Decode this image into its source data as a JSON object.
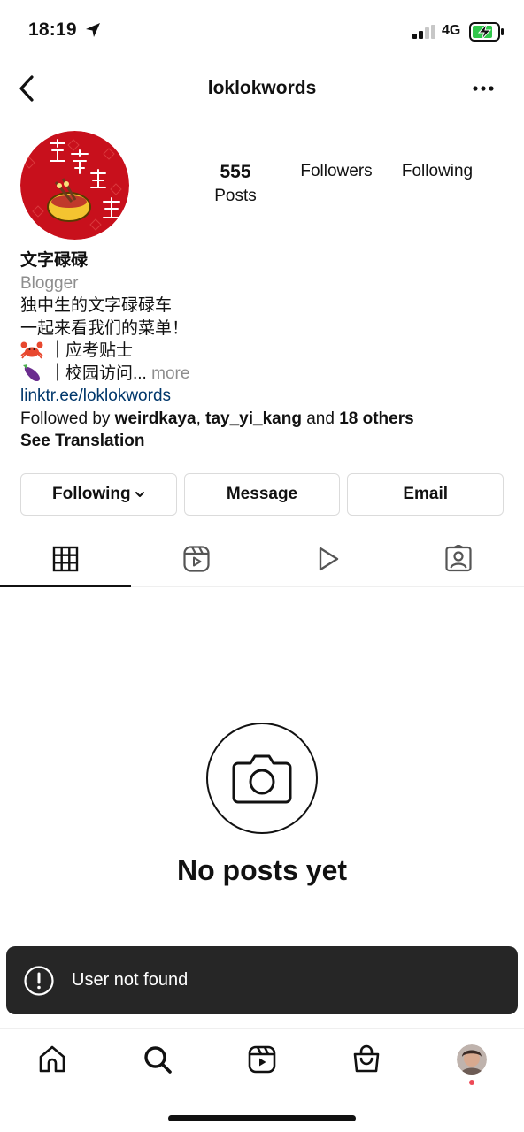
{
  "status_bar": {
    "time": "18:19",
    "network": "4G"
  },
  "header": {
    "username": "loklokwords"
  },
  "profile": {
    "stats": {
      "posts_count": "555",
      "posts_label": "Posts",
      "followers_label": "Followers",
      "following_label": "Following"
    },
    "name": "文字碌碌",
    "category": "Blogger",
    "bio_line1": "独中生的文字碌碌车",
    "bio_line2": "一起来看我们的菜单！",
    "bio_line3": "｜应考贴士",
    "bio_line4": "｜校园访问...",
    "more": " more",
    "link": "linktr.ee/loklokwords",
    "followed_by_prefix": "Followed by ",
    "followed_by_user1": "weirdkaya",
    "followed_by_sep": ", ",
    "followed_by_user2": "tay_yi_kang",
    "followed_by_and": " and ",
    "followed_by_others": "18 others",
    "see_translation": "See Translation"
  },
  "actions": {
    "following": "Following",
    "message": "Message",
    "email": "Email"
  },
  "tabs": [
    "grid-icon",
    "reels-icon",
    "play-icon",
    "tagged-icon"
  ],
  "empty_state": {
    "title": "No posts yet"
  },
  "toast": {
    "message": "User not found"
  },
  "bottom_nav": [
    "home-icon",
    "search-icon",
    "reels-icon",
    "shop-icon",
    "profile-avatar"
  ],
  "colors": {
    "link": "#00376b",
    "muted": "#8e8e8e",
    "toast_bg": "#262626",
    "notification_dot": "#ed4956",
    "battery_green": "#30c74b"
  }
}
